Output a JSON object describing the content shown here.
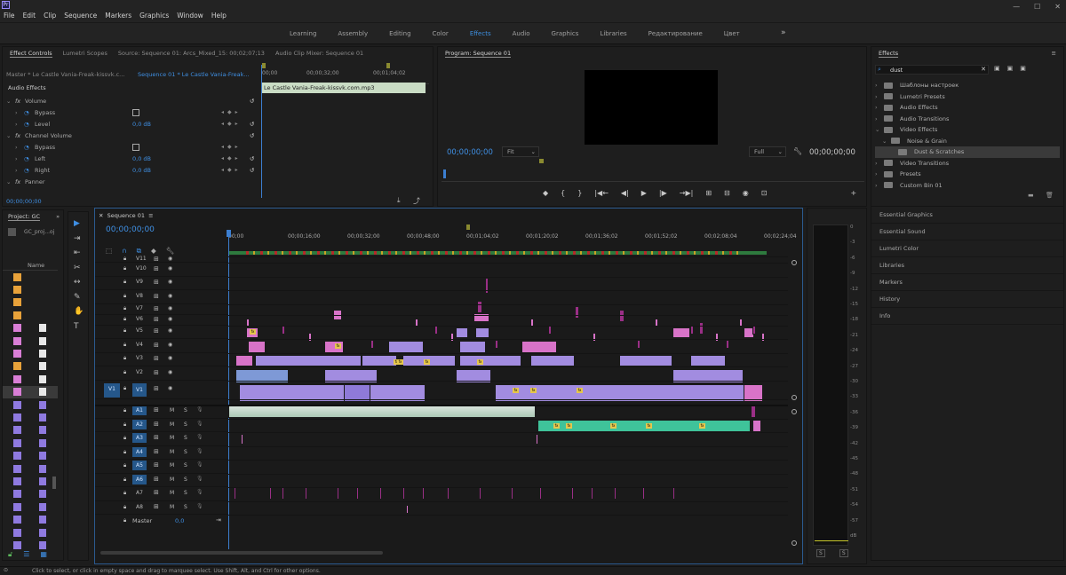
{
  "menu": {
    "logo": "Pr",
    "items": [
      "File",
      "Edit",
      "Clip",
      "Sequence",
      "Markers",
      "Graphics",
      "Window",
      "Help"
    ]
  },
  "workspaces": {
    "tabs": [
      "Learning",
      "Assembly",
      "Editing",
      "Color",
      "Effects",
      "Audio",
      "Graphics",
      "Libraries",
      "Редактирование",
      "Цвет"
    ],
    "active": "Effects",
    "more": "»"
  },
  "effect_controls": {
    "tabs": [
      "Effect Controls",
      "Lumetri Scopes",
      "Source: Sequence 01: Arcs_Mixed_15: 00;02;07;13",
      "Audio Clip Mixer: Sequence 01"
    ],
    "master": "Master * Le Castle Vania-Freak-kissvk.c...",
    "sequence": "Sequence 01 * Le Castle Vania-Freak...",
    "ruler": [
      "00;00",
      "00;00;32;00",
      "00;01;04;02"
    ],
    "clip_name": "Le Castle Vania-Freak-kissvk.com.mp3",
    "section": "Audio Effects",
    "rows": [
      {
        "fx": "fx",
        "name": "Volume"
      },
      {
        "name": "Bypass"
      },
      {
        "name": "Level",
        "value": "0,0 dB"
      },
      {
        "fx": "fx",
        "name": "Channel Volume"
      },
      {
        "name": "Bypass"
      },
      {
        "name": "Left",
        "value": "0,0 dB"
      },
      {
        "name": "Right",
        "value": "0,0 dB"
      },
      {
        "fx": "fx",
        "name": "Panner"
      }
    ],
    "timecode": "00;00;00;00"
  },
  "program": {
    "title": "Program: Sequence 01",
    "timecode_left": "00;00;00;00",
    "fit": "Fit",
    "full": "Full",
    "timecode_right": "00;00;00;00",
    "transport": [
      "◆",
      "{",
      "}",
      "|◀←",
      "◀|",
      "▶",
      "|▶",
      "→▶|",
      "⊞",
      "⊟",
      "◉",
      "⊡",
      "+"
    ]
  },
  "effects": {
    "title": "Effects",
    "search": "dust",
    "items": [
      {
        "label": "Шаблоны настроек",
        "indent": 0
      },
      {
        "label": "Lumetri Presets",
        "indent": 0
      },
      {
        "label": "Audio Effects",
        "indent": 0
      },
      {
        "label": "Audio Transitions",
        "indent": 0
      },
      {
        "label": "Video Effects",
        "indent": 0
      },
      {
        "label": "Noise & Grain",
        "indent": 1
      },
      {
        "label": "Dust & Scratches",
        "indent": 2
      },
      {
        "label": "Video Transitions",
        "indent": 0
      },
      {
        "label": "Presets",
        "indent": 0
      },
      {
        "label": "Custom Bin 01",
        "indent": 0
      }
    ],
    "sections": [
      "Essential Graphics",
      "Essential Sound",
      "Lumetri Color",
      "Libraries",
      "Markers",
      "History",
      "Info"
    ]
  },
  "project": {
    "title": "Project: GC",
    "file": "GC_proj...oj",
    "col": "Name"
  },
  "sequence": {
    "tab": "Sequence 01",
    "timecode": "00;00;00;00",
    "ruler": [
      "00;00",
      "00;00;16;00",
      "00;00;32;00",
      "00;00;48;00",
      "00;01;04;02",
      "00;01;20;02",
      "00;01;36;02",
      "00;01;52;02",
      "00;02;08;04",
      "00;02;24;04"
    ],
    "video_tracks": [
      "V11",
      "V10",
      "V9",
      "V8",
      "V7",
      "V6",
      "V5",
      "V4",
      "V3",
      "V2",
      "V1"
    ],
    "audio_tracks": [
      "A1",
      "A2",
      "A3",
      "A4",
      "A5",
      "A6",
      "A7",
      "A8"
    ],
    "master_label": "Master",
    "master_value": "0,0",
    "src_v": "V1"
  },
  "meter": {
    "ticks": [
      "0",
      "-3",
      "-6",
      "-9",
      "-12",
      "-15",
      "-18",
      "-21",
      "-24",
      "-27",
      "-30",
      "-33",
      "-36",
      "-39",
      "-42",
      "-45",
      "-48",
      "-51",
      "-54",
      "-57",
      "dB"
    ],
    "solo": [
      "S",
      "S"
    ]
  },
  "status": "Click to select, or click in empty space and drag to marquee select. Use Shift, Alt, and Ctrl for other options.",
  "colors": {
    "accent": "#3d8fe0",
    "video_clip": "#a28ce0",
    "pink_clip": "#d873c8",
    "audio_clip": "#3fc39a"
  }
}
